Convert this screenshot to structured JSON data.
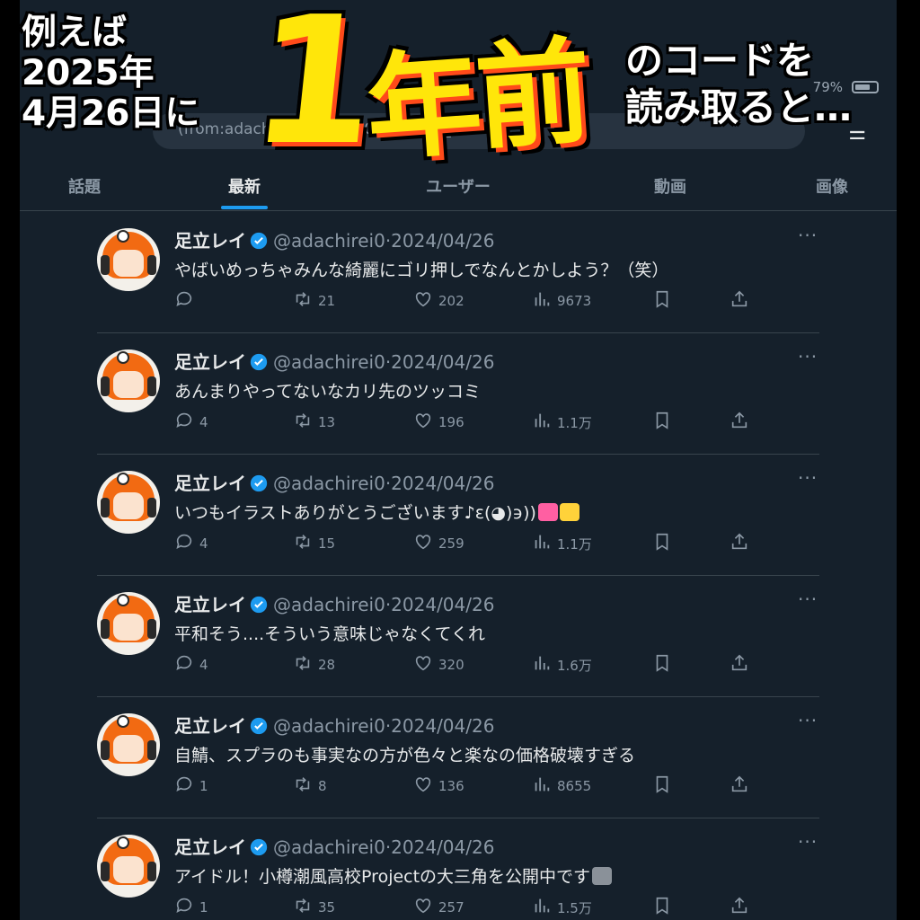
{
  "banner": {
    "left_lines": [
      "例えば",
      "2025年",
      "4月26日に"
    ],
    "big_one": "1",
    "big_nen": "年",
    "big_mae": "前",
    "right_lines": [
      "のコードを",
      "読み取ると…"
    ]
  },
  "status": {
    "battery": "79%"
  },
  "search": {
    "query": "(from:adachirei0) until:2024-04-26_2..."
  },
  "tabs": [
    "話題",
    "最新",
    "ユーザー",
    "動画",
    "画像"
  ],
  "active_tab": "最新",
  "colors": {
    "accent": "#1d9bf0",
    "background": "#15202b",
    "highlight": "#ffe60a",
    "shadow": "#ff4a1a"
  },
  "tweets": [
    {
      "name": "足立レイ",
      "handle": "@adachirei0",
      "date": "2024/04/26",
      "text": "やばいめっちゃみんな綺麗にゴリ押しでなんとかしよう？（笑）",
      "replies": "",
      "retweets": "21",
      "likes": "202",
      "views": "9673"
    },
    {
      "name": "足立レイ",
      "handle": "@adachirei0",
      "date": "2024/04/26",
      "text": "あんまりやってないなカリ先のツッコミ",
      "replies": "4",
      "retweets": "13",
      "likes": "196",
      "views": "1.1万"
    },
    {
      "name": "足立レイ",
      "handle": "@adachirei0",
      "date": "2024/04/26",
      "text": "いつもイラストありがとうございます♪ɛ(◕)϶))",
      "emojis": [
        "heart-emoji",
        "sparkles-emoji"
      ],
      "replies": "4",
      "retweets": "15",
      "likes": "259",
      "views": "1.1万"
    },
    {
      "name": "足立レイ",
      "handle": "@adachirei0",
      "date": "2024/04/26",
      "text": "平和そう....そういう意味じゃなくてくれ",
      "replies": "4",
      "retweets": "28",
      "likes": "320",
      "views": "1.6万"
    },
    {
      "name": "足立レイ",
      "handle": "@adachirei0",
      "date": "2024/04/26",
      "text": "自鯖、スプラのも事実なの方が色々と楽なの価格破壊すぎる",
      "replies": "1",
      "retweets": "8",
      "likes": "136",
      "views": "8655"
    },
    {
      "name": "足立レイ",
      "handle": "@adachirei0",
      "date": "2024/04/26",
      "text": "アイドル！小樽潮風高校Projectの大三角を公開中です",
      "emojis": [
        "tv-emoji"
      ],
      "replies": "1",
      "retweets": "35",
      "likes": "257",
      "views": "1.5万"
    }
  ]
}
